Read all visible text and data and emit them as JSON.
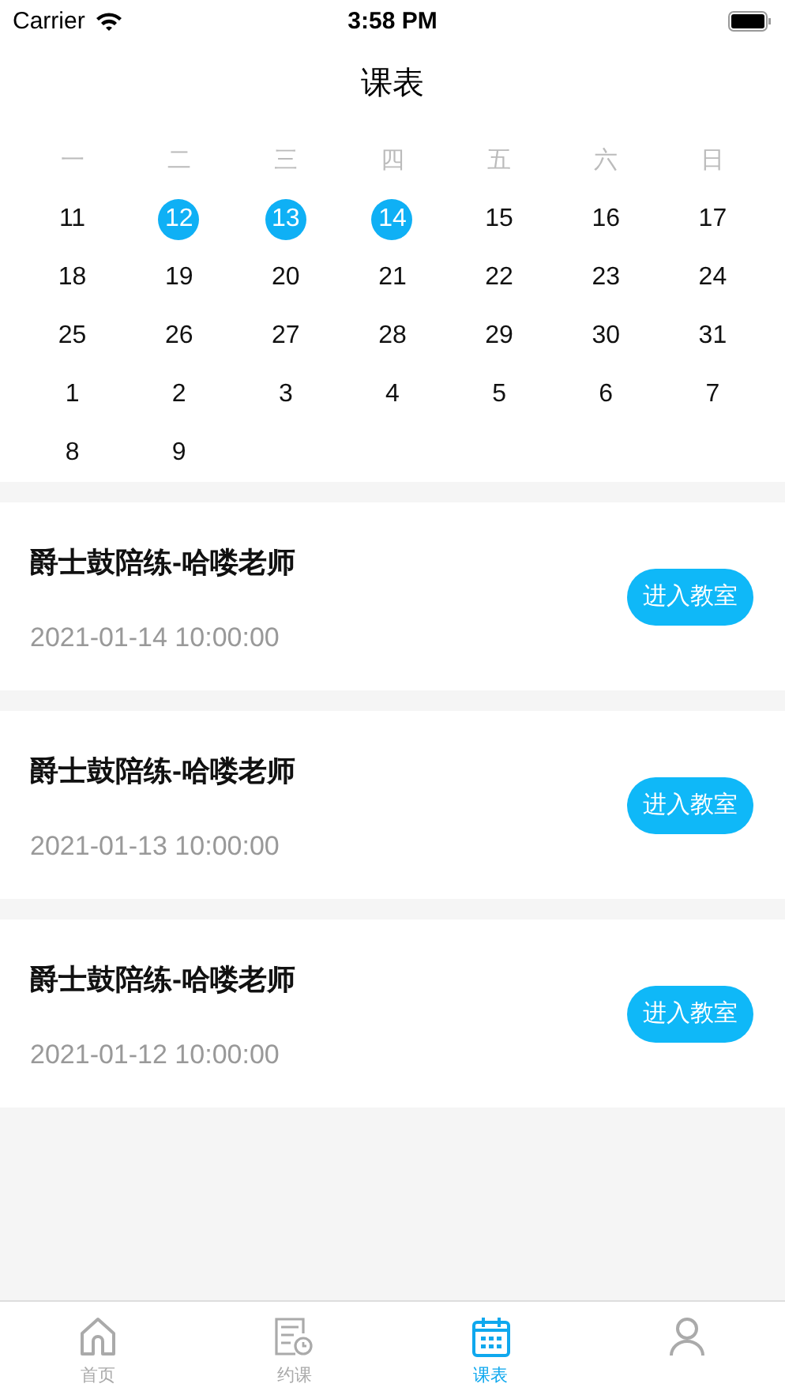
{
  "status_bar": {
    "carrier": "Carrier",
    "time": "3:58 PM"
  },
  "title": "课表",
  "calendar": {
    "weekdays": [
      "一",
      "二",
      "三",
      "四",
      "五",
      "六",
      "日"
    ],
    "days": [
      {
        "label": "11",
        "selected": false
      },
      {
        "label": "12",
        "selected": true
      },
      {
        "label": "13",
        "selected": true
      },
      {
        "label": "14",
        "selected": true
      },
      {
        "label": "15",
        "selected": false
      },
      {
        "label": "16",
        "selected": false
      },
      {
        "label": "17",
        "selected": false
      },
      {
        "label": "18",
        "selected": false
      },
      {
        "label": "19",
        "selected": false
      },
      {
        "label": "20",
        "selected": false
      },
      {
        "label": "21",
        "selected": false
      },
      {
        "label": "22",
        "selected": false
      },
      {
        "label": "23",
        "selected": false
      },
      {
        "label": "24",
        "selected": false
      },
      {
        "label": "25",
        "selected": false
      },
      {
        "label": "26",
        "selected": false
      },
      {
        "label": "27",
        "selected": false
      },
      {
        "label": "28",
        "selected": false
      },
      {
        "label": "29",
        "selected": false
      },
      {
        "label": "30",
        "selected": false
      },
      {
        "label": "31",
        "selected": false
      },
      {
        "label": "1",
        "selected": false
      },
      {
        "label": "2",
        "selected": false
      },
      {
        "label": "3",
        "selected": false
      },
      {
        "label": "4",
        "selected": false
      },
      {
        "label": "5",
        "selected": false
      },
      {
        "label": "6",
        "selected": false
      },
      {
        "label": "7",
        "selected": false
      },
      {
        "label": "8",
        "selected": false
      },
      {
        "label": "9",
        "selected": false
      }
    ]
  },
  "lessons": [
    {
      "title": "爵士鼓陪练-哈喽老师",
      "time": "2021-01-14 10:00:00",
      "button": "进入教室"
    },
    {
      "title": "爵士鼓陪练-哈喽老师",
      "time": "2021-01-13 10:00:00",
      "button": "进入教室"
    },
    {
      "title": "爵士鼓陪练-哈喽老师",
      "time": "2021-01-12 10:00:00",
      "button": "进入教室"
    }
  ],
  "tab_bar": [
    {
      "kind": "home",
      "label": "首页",
      "selected": false
    },
    {
      "kind": "booking",
      "label": "约课",
      "selected": false
    },
    {
      "kind": "calendar",
      "label": "课表",
      "selected": true
    },
    {
      "kind": "profile",
      "selected": false
    }
  ]
}
